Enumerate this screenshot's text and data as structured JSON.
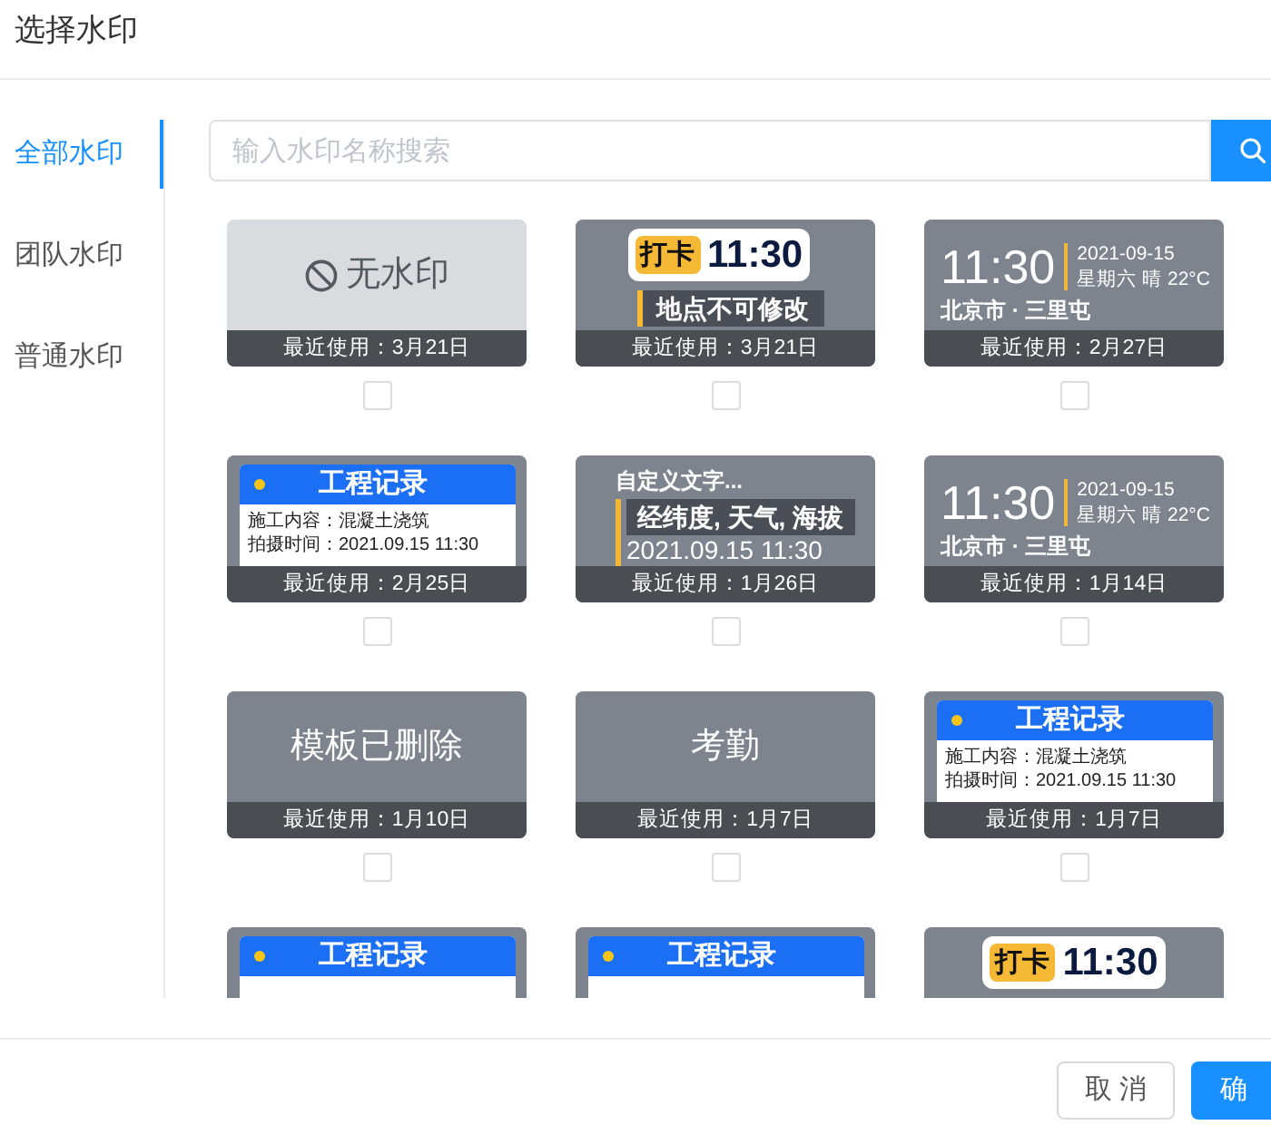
{
  "dialog": {
    "title": "选择水印"
  },
  "sidebar": {
    "items": [
      {
        "label": "全部水印",
        "selected": true
      },
      {
        "label": "团队水印",
        "selected": false
      },
      {
        "label": "普通水印",
        "selected": false
      }
    ]
  },
  "search": {
    "placeholder": "输入水印名称搜索"
  },
  "watermarks": [
    {
      "kind": "none",
      "label": "无水印",
      "last_used": "最近使用：3月21日",
      "checked": false
    },
    {
      "kind": "punch",
      "tag": "打卡",
      "time": "11:30",
      "location": "地点不可修改",
      "last_used": "最近使用：3月21日",
      "checked": false
    },
    {
      "kind": "time_weather",
      "time": "11:30",
      "date": "2021-09-15",
      "weather": "星期六 晴 22°C",
      "place": "北京市 · 三里屯",
      "last_used": "最近使用：2月27日",
      "checked": false
    },
    {
      "kind": "engineering",
      "title": "工程记录",
      "rows": [
        "施工内容：混凝土浇筑",
        "拍摄时间：2021.09.15 11:30"
      ],
      "last_used": "最近使用：2月25日",
      "checked": false
    },
    {
      "kind": "custom",
      "heading": "自定义文字...",
      "fields": "经纬度, 天气, 海拔",
      "datetime": "2021.09.15 11:30",
      "last_used": "最近使用：1月26日",
      "checked": false
    },
    {
      "kind": "time_weather",
      "time": "11:30",
      "date": "2021-09-15",
      "weather": "星期六 晴 22°C",
      "place": "北京市 · 三里屯",
      "last_used": "最近使用：1月14日",
      "checked": false
    },
    {
      "kind": "text",
      "label": "模板已删除",
      "last_used": "最近使用：1月10日",
      "checked": false
    },
    {
      "kind": "text",
      "label": "考勤",
      "last_used": "最近使用：1月7日",
      "checked": false
    },
    {
      "kind": "engineering",
      "title": "工程记录",
      "rows": [
        "施工内容：混凝土浇筑",
        "拍摄时间：2021.09.15 11:30"
      ],
      "last_used": "最近使用：1月7日",
      "checked": false
    },
    {
      "kind": "engineering",
      "title": "工程记录"
    },
    {
      "kind": "engineering",
      "title": "工程记录"
    },
    {
      "kind": "punch",
      "tag": "打卡",
      "time": "11:30"
    }
  ],
  "buttons": [
    {
      "label": "取消",
      "kind": "secondary"
    },
    {
      "label": "确",
      "kind": "primary"
    }
  ]
}
